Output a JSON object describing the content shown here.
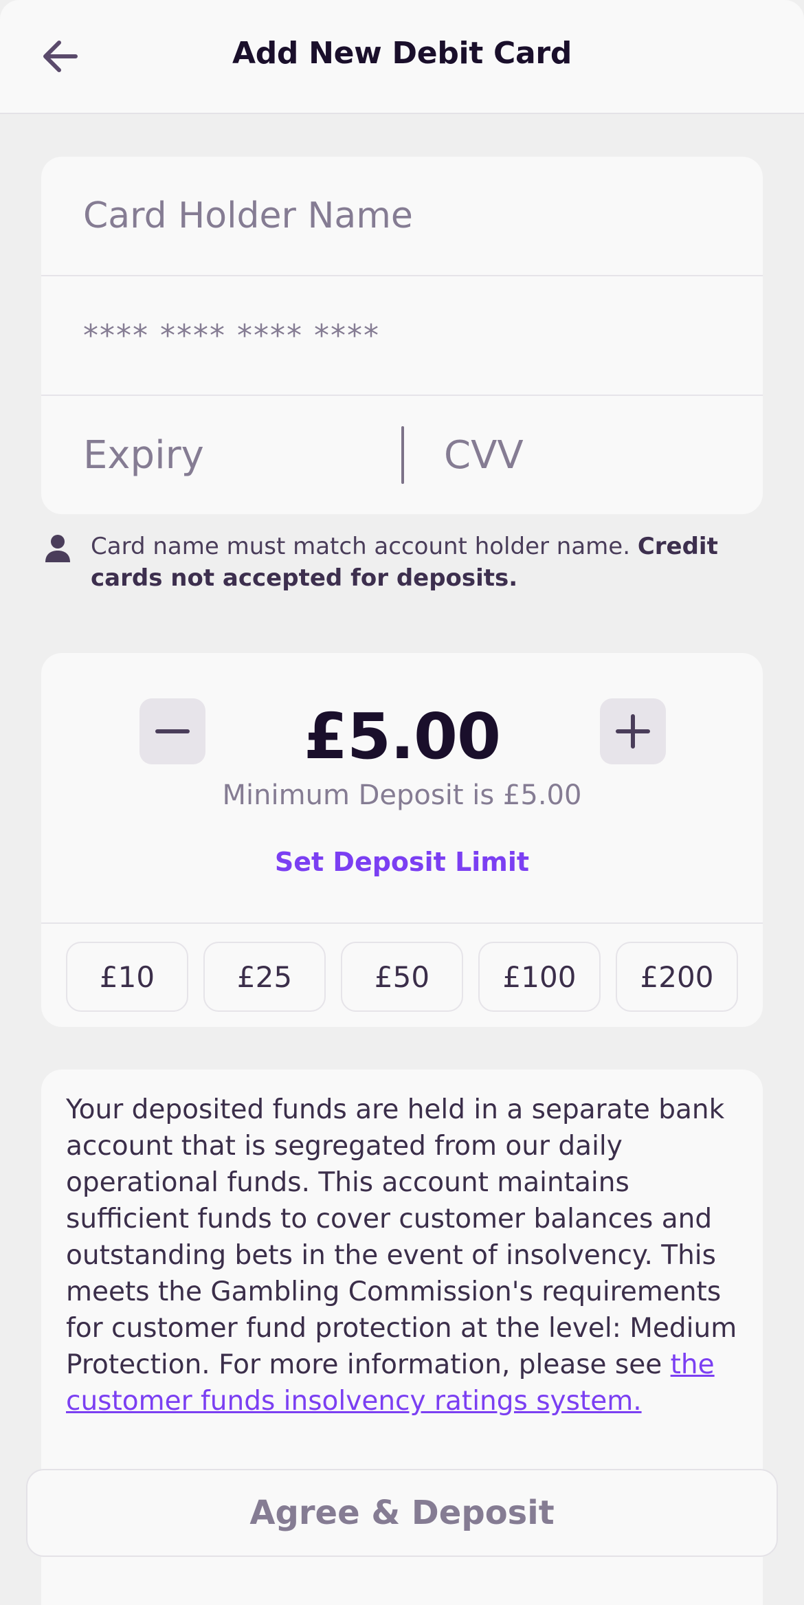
{
  "header": {
    "title": "Add New Debit Card",
    "back_icon": "arrow-left-icon"
  },
  "card_form": {
    "name_placeholder": "Card Holder Name",
    "number_placeholder": "**** **** **** ****",
    "expiry_placeholder": "Expiry",
    "cvv_placeholder": "CVV"
  },
  "note": {
    "icon": "user-icon",
    "text": "Card name must match account holder name. ",
    "bold_text": "Credit cards not accepted for deposits."
  },
  "deposit": {
    "amount": "£5.00",
    "minus_icon": "minus-icon",
    "plus_icon": "plus-icon",
    "minimum_note": "Minimum Deposit is £5.00",
    "limit_link": "Set Deposit Limit",
    "quick_amounts": [
      "£10",
      "£25",
      "£50",
      "£100",
      "£200"
    ]
  },
  "info": {
    "text": "Your deposited funds are held in a separate bank account that is segregated from our daily operational funds. This account maintains sufficient funds to cover customer balances and outstanding bets in the event of insolvency. This meets the Gambling Commission's requirements for customer fund protection at the level: Medium Protection. For more information, please see ",
    "link_text": "the customer funds insolvency ratings system."
  },
  "agree_button": "Agree & Deposit",
  "colors": {
    "accent": "#7b3ff2",
    "muted_text": "#857c93",
    "dark_text": "#1a0f2b",
    "background": "#efefef",
    "card": "#f9f9f9"
  }
}
